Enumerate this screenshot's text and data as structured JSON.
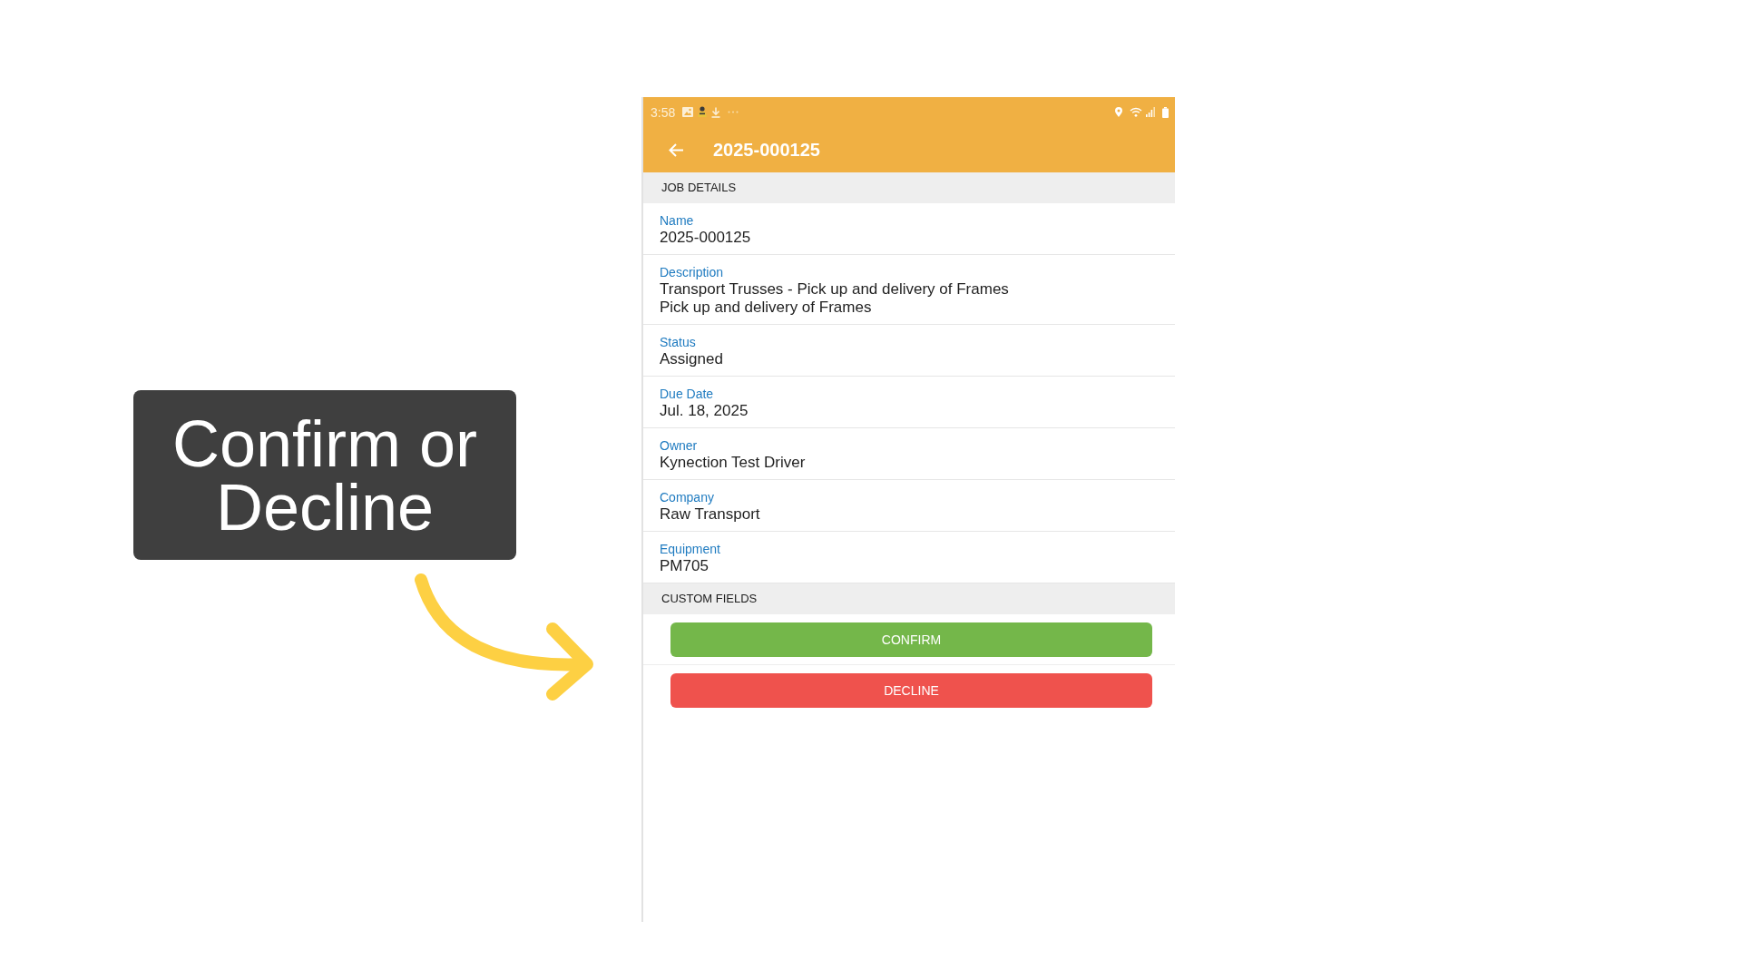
{
  "callout": {
    "text": "Confirm or Decline"
  },
  "status_bar": {
    "time": "3:58"
  },
  "app_bar": {
    "title": "2025-000125"
  },
  "sections": [
    {
      "header": "JOB DETAILS",
      "fields": [
        {
          "label": "Name",
          "value": "2025-000125"
        },
        {
          "label": "Description",
          "value": "Transport Trusses - Pick up and delivery of Frames\nPick up and delivery of Frames"
        },
        {
          "label": "Status",
          "value": "Assigned"
        },
        {
          "label": "Due Date",
          "value": "Jul. 18, 2025"
        },
        {
          "label": "Owner",
          "value": "Kynection Test Driver"
        },
        {
          "label": "Company",
          "value": "Raw Transport"
        },
        {
          "label": "Equipment",
          "value": "PM705"
        }
      ]
    },
    {
      "header": "CUSTOM FIELDS",
      "buttons": [
        {
          "label": "CONFIRM",
          "kind": "confirm"
        },
        {
          "label": "DECLINE",
          "kind": "decline"
        }
      ]
    }
  ]
}
